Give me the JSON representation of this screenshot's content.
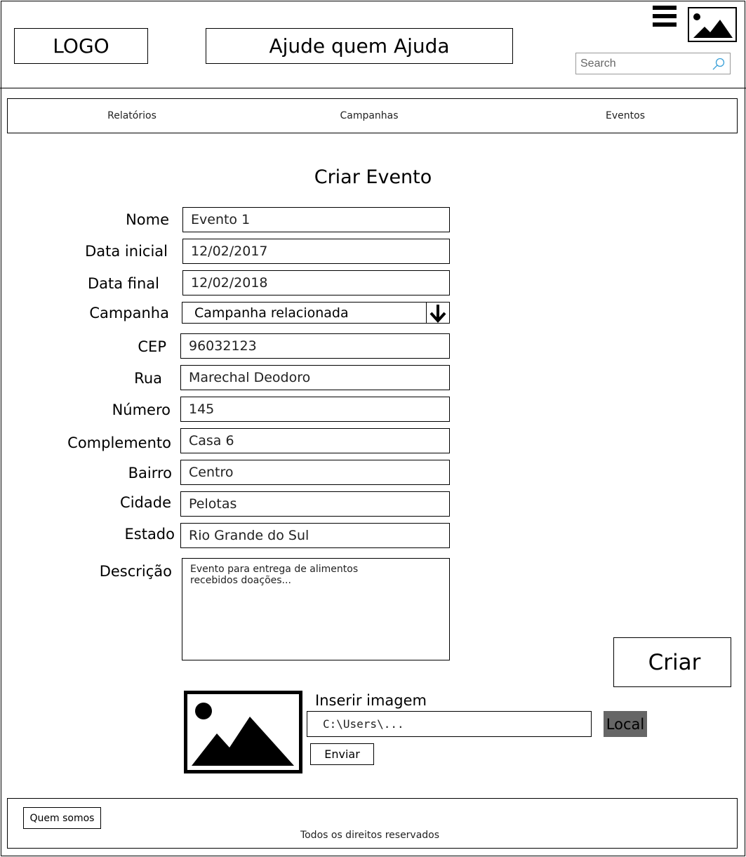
{
  "header": {
    "logo": "LOGO",
    "title": "Ajude quem Ajuda",
    "search_placeholder": "Search",
    "menu_icon": "hamburger-menu-icon",
    "image_icon": "image-placeholder-icon"
  },
  "nav": {
    "items": [
      {
        "label": "Relatórios"
      },
      {
        "label": "Campanhas"
      },
      {
        "label": "Eventos"
      }
    ]
  },
  "form": {
    "title": "Criar Evento",
    "nome": {
      "label": "Nome",
      "value": "Evento 1"
    },
    "data_inicial": {
      "label": "Data inicial",
      "value": "12/02/2017"
    },
    "data_final": {
      "label": "Data final",
      "value": "12/02/2018"
    },
    "campanha": {
      "label": "Campanha",
      "value": "Campanha relacionada"
    },
    "cep": {
      "label": "CEP",
      "value": "96032123"
    },
    "rua": {
      "label": "Rua",
      "value": "Marechal Deodoro"
    },
    "numero": {
      "label": "Número",
      "value": "145"
    },
    "complemento": {
      "label": "Complemento",
      "value": "Casa 6"
    },
    "bairro": {
      "label": "Bairro",
      "value": "Centro"
    },
    "cidade": {
      "label": "Cidade",
      "value": "Pelotas"
    },
    "estado": {
      "label": "Estado",
      "value": "Rio Grande do Sul"
    },
    "descricao": {
      "label": "Descrição",
      "value": "Evento para entrega de alimentos\nrecebidos doações..."
    },
    "submit_label": "Criar"
  },
  "upload": {
    "label": "Inserir imagem",
    "path": "C:\\Users\\...",
    "local_label": "Local",
    "send_label": "Enviar"
  },
  "footer": {
    "about_label": "Quem somos",
    "copyright": "Todos os direitos reservados"
  },
  "colors": {
    "local_button_bg": "#666666",
    "search_icon": "#3aa0d8"
  }
}
